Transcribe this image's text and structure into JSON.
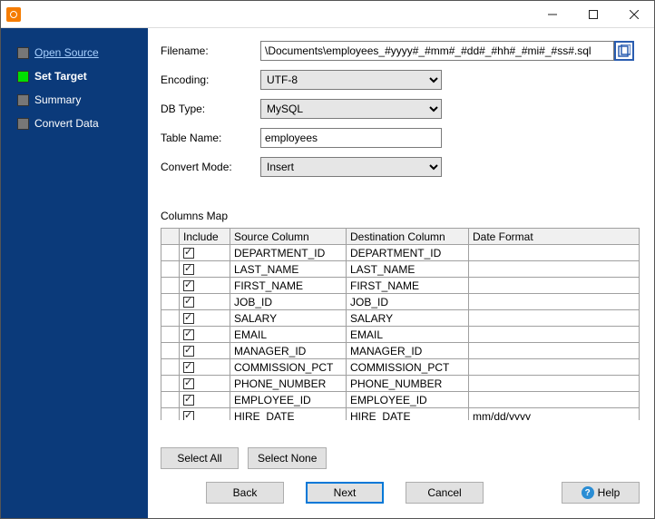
{
  "sidebar": {
    "items": [
      {
        "label": "Open Source",
        "current": false
      },
      {
        "label": "Set Target",
        "current": true
      },
      {
        "label": "Summary",
        "current": false
      },
      {
        "label": "Convert Data",
        "current": false
      }
    ]
  },
  "form": {
    "filename_label": "Filename:",
    "filename_value": "\\Documents\\employees_#yyyy#_#mm#_#dd#_#hh#_#mi#_#ss#.sql",
    "encoding_label": "Encoding:",
    "encoding_value": "UTF-8",
    "dbtype_label": "DB Type:",
    "dbtype_value": "MySQL",
    "tablename_label": "Table Name:",
    "tablename_value": "employees",
    "convertmode_label": "Convert Mode:",
    "convertmode_value": "Insert"
  },
  "columns_map": {
    "title": "Columns Map",
    "headers": {
      "include": "Include",
      "source": "Source Column",
      "dest": "Destination Column",
      "datefmt": "Date Format"
    },
    "rows": [
      {
        "include": true,
        "source": "DEPARTMENT_ID",
        "dest": "DEPARTMENT_ID",
        "datefmt": ""
      },
      {
        "include": true,
        "source": "LAST_NAME",
        "dest": "LAST_NAME",
        "datefmt": ""
      },
      {
        "include": true,
        "source": "FIRST_NAME",
        "dest": "FIRST_NAME",
        "datefmt": ""
      },
      {
        "include": true,
        "source": "JOB_ID",
        "dest": "JOB_ID",
        "datefmt": ""
      },
      {
        "include": true,
        "source": "SALARY",
        "dest": "SALARY",
        "datefmt": ""
      },
      {
        "include": true,
        "source": "EMAIL",
        "dest": "EMAIL",
        "datefmt": ""
      },
      {
        "include": true,
        "source": "MANAGER_ID",
        "dest": "MANAGER_ID",
        "datefmt": ""
      },
      {
        "include": true,
        "source": "COMMISSION_PCT",
        "dest": "COMMISSION_PCT",
        "datefmt": ""
      },
      {
        "include": true,
        "source": "PHONE_NUMBER",
        "dest": "PHONE_NUMBER",
        "datefmt": ""
      },
      {
        "include": true,
        "source": "EMPLOYEE_ID",
        "dest": "EMPLOYEE_ID",
        "datefmt": ""
      },
      {
        "include": true,
        "source": "HIRE_DATE",
        "dest": "HIRE_DATE",
        "datefmt": "mm/dd/yyyy"
      }
    ]
  },
  "buttons": {
    "select_all": "Select All",
    "select_none": "Select None",
    "back": "Back",
    "next": "Next",
    "cancel": "Cancel",
    "help": "Help"
  }
}
